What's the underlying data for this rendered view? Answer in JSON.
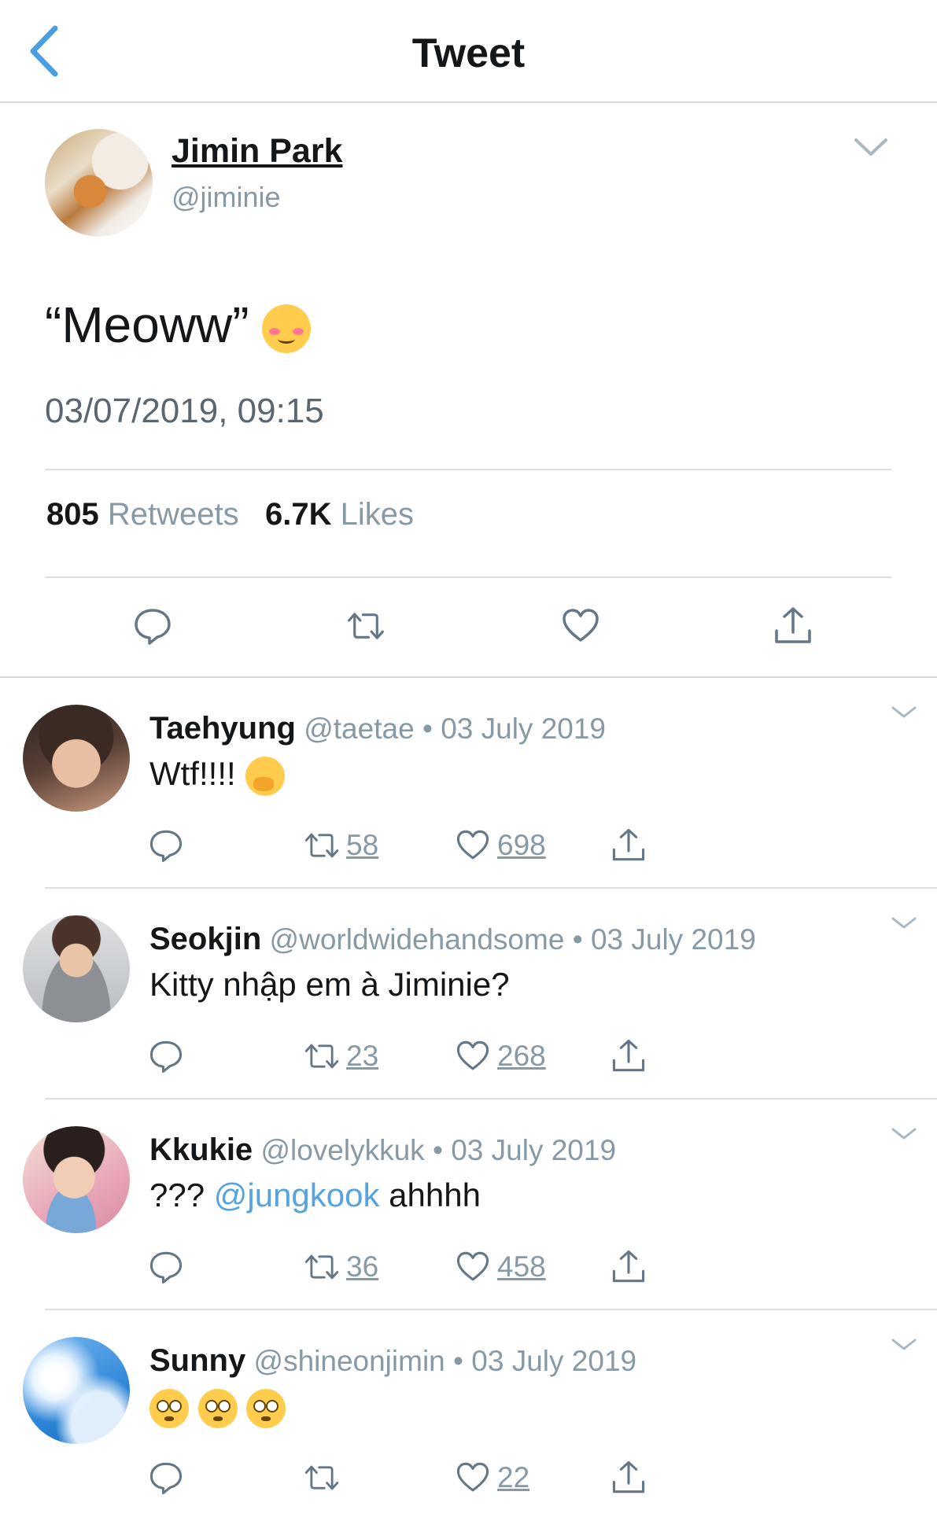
{
  "header": {
    "title": "Tweet",
    "back_icon": "chevron-left-icon"
  },
  "colors": {
    "accent": "#55a3df",
    "muted": "#8899a6",
    "text": "#14171a"
  },
  "main_tweet": {
    "name": "Jimin Park",
    "handle": "@jiminie",
    "text": "“Meoww”",
    "emoji": "smiling-face-with-blush",
    "timestamp": "03/07/2019, 09:15",
    "retweets_count": "805",
    "retweets_label": "Retweets",
    "likes_count": "6.7K",
    "likes_label": "Likes"
  },
  "replies": [
    {
      "name": "Taehyung",
      "handle": "@taetae",
      "dot": "•",
      "date": "03 July 2019",
      "text": "Wtf!!!!",
      "emoji": "face-with-hand-over-mouth",
      "retweets": "58",
      "likes": "698"
    },
    {
      "name": "Seokjin",
      "handle": "@worldwidehandsome",
      "dot": "•",
      "date": "03 July 2019",
      "text": "Kitty nhập em à Jiminie?",
      "retweets": "23",
      "likes": "268"
    },
    {
      "name": "Kkukie",
      "handle": "@lovelykkuk",
      "dot": "•",
      "date": "03 July 2019",
      "text_prefix": "??? ",
      "mention": "@jungkook",
      "text_suffix": " ahhhh",
      "retweets": "36",
      "likes": "458"
    },
    {
      "name": "Sunny",
      "handle": "@shineonjimin",
      "dot": "•",
      "date": "03 July 2019",
      "emoji": "flushed-face ×3",
      "retweets": "",
      "likes": "22"
    }
  ]
}
